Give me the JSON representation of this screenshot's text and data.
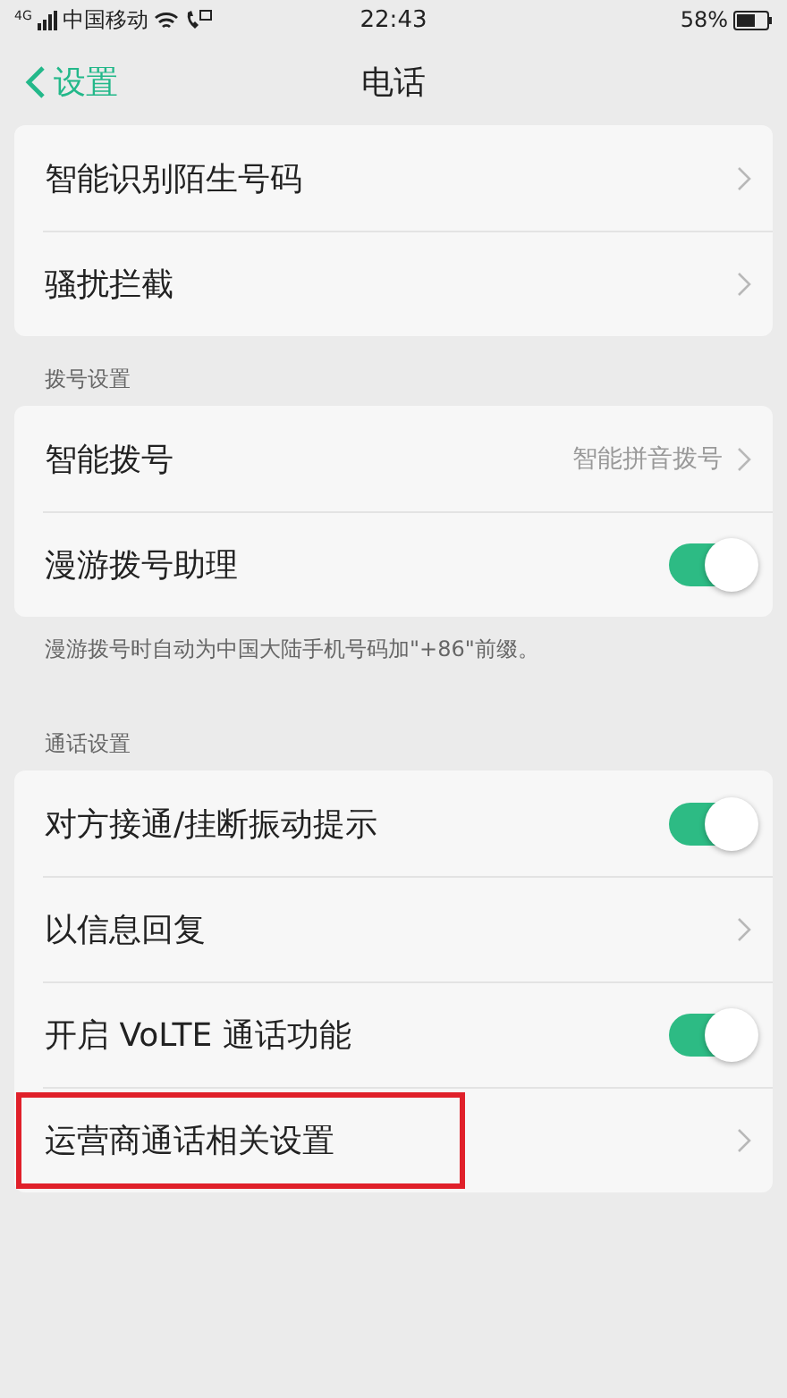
{
  "status_bar": {
    "network": "4G",
    "carrier": "中国移动",
    "time": "22:43",
    "battery": "58%"
  },
  "nav": {
    "back": "设置",
    "title": "电话"
  },
  "groups": [
    {
      "rows": [
        {
          "kind": "link",
          "label": "智能识别陌生号码",
          "highlighted": false
        },
        {
          "kind": "link",
          "label": "骚扰拦截",
          "highlighted": false
        }
      ]
    },
    {
      "header": "拨号设置",
      "footer": "漫游拨号时自动为中国大陆手机号码加\"+86\"前缀。",
      "rows": [
        {
          "kind": "link",
          "label": "智能拨号",
          "value": "智能拼音拨号",
          "highlighted": false
        },
        {
          "kind": "toggle",
          "label": "漫游拨号助理",
          "on": true,
          "highlighted": false
        }
      ]
    },
    {
      "header": "通话设置",
      "rows": [
        {
          "kind": "toggle",
          "label": "对方接通/挂断振动提示",
          "on": true,
          "highlighted": false
        },
        {
          "kind": "link",
          "label": "以信息回复",
          "highlighted": false
        },
        {
          "kind": "toggle",
          "label": "开启 VoLTE 通话功能",
          "on": true,
          "highlighted": false
        },
        {
          "kind": "link",
          "label": "运营商通话相关设置",
          "highlighted": true
        }
      ]
    }
  ]
}
